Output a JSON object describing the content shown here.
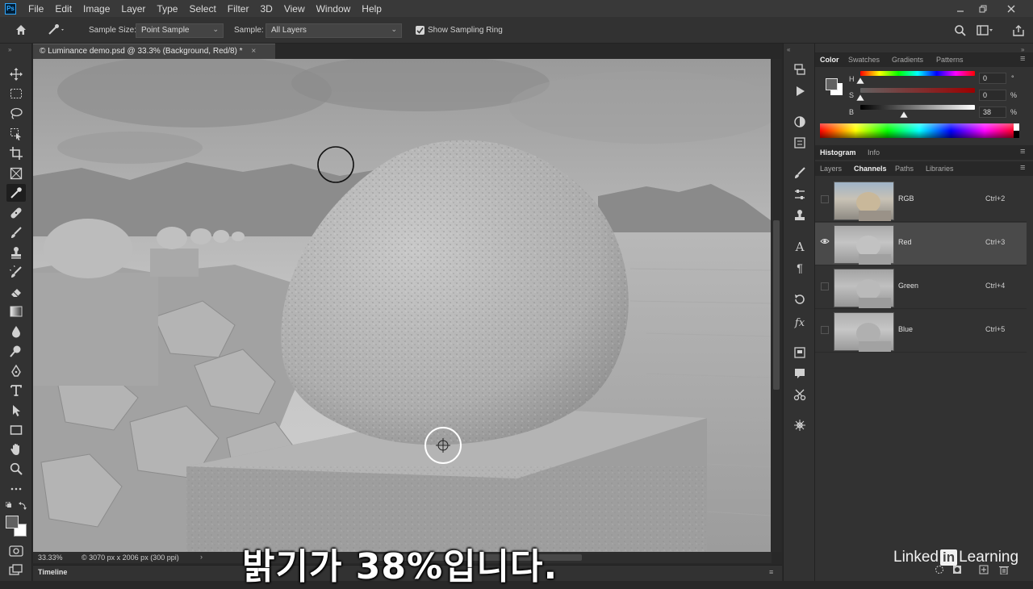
{
  "menu": {
    "logo": "Ps",
    "items": [
      "File",
      "Edit",
      "Image",
      "Layer",
      "Type",
      "Select",
      "Filter",
      "3D",
      "View",
      "Window",
      "Help"
    ]
  },
  "options_bar": {
    "sample_size_label": "Sample Size:",
    "sample_size_value": "Point Sample",
    "sample_label": "Sample:",
    "sample_value": "All Layers",
    "show_sampling_ring": "Show Sampling Ring"
  },
  "document": {
    "tab_title": "© Luminance demo.psd @ 33.3% (Background, Red/8) *",
    "zoom": "33.33%",
    "doc_info": "© 3070 px x 2006 px (300 ppi)"
  },
  "timeline_label": "Timeline",
  "color_panel": {
    "tabs": [
      "Color",
      "Swatches",
      "Gradients",
      "Patterns"
    ],
    "active_tab": "Color",
    "h_label": "H",
    "h_value": "0",
    "h_unit": "°",
    "s_label": "S",
    "s_value": "0",
    "s_unit": "%",
    "b_label": "B",
    "b_value": "38",
    "b_unit": "%",
    "h_level": 0,
    "s_level": 0,
    "b_level": 0.38
  },
  "histogram_panel": {
    "tabs": [
      "Histogram",
      "Info"
    ],
    "active_tab": "Histogram"
  },
  "channels_panel": {
    "tabs": [
      "Layers",
      "Channels",
      "Paths",
      "Libraries"
    ],
    "active_tab": "Channels",
    "channels": [
      {
        "name": "RGB",
        "shortcut": "Ctrl+2"
      },
      {
        "name": "Red",
        "shortcut": "Ctrl+3"
      },
      {
        "name": "Green",
        "shortcut": "Ctrl+4"
      },
      {
        "name": "Blue",
        "shortcut": "Ctrl+5"
      }
    ]
  },
  "subtitle": "밝기가 38%입니다.",
  "brand": {
    "left": "Linked",
    "in": "in",
    "right": "Learning"
  }
}
